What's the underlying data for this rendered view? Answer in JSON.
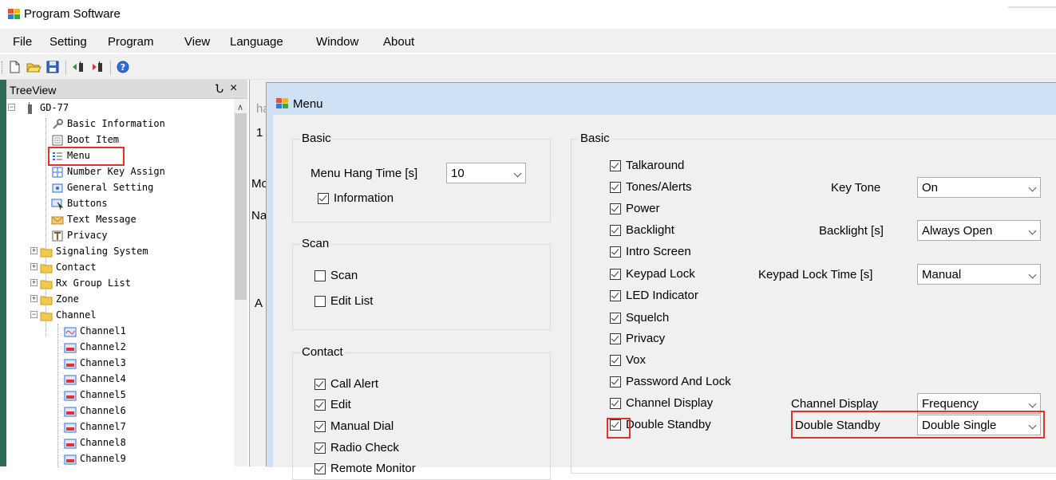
{
  "app": {
    "title": "Program Software"
  },
  "menubar": {
    "items": [
      "File",
      "Setting",
      "Program",
      "View",
      "Language",
      "Window",
      "About"
    ]
  },
  "toolbar": {
    "icons": [
      "new-file-icon",
      "open-folder-icon",
      "save-icon",
      "read-from-radio-icon",
      "write-to-radio-icon",
      "help-icon"
    ]
  },
  "treeview": {
    "title": "TreeView",
    "pin_glyph": "Ն",
    "close_glyph": "×",
    "root": "GD-77",
    "items": [
      "Basic Information",
      "Boot Item",
      "Menu",
      "Number Key Assign",
      "General Setting",
      "Buttons",
      "Text Message",
      "Privacy",
      "Signaling System",
      "Contact",
      "Rx Group List",
      "Zone",
      "Channel"
    ],
    "channels": [
      "Channel1",
      "Channel2",
      "Channel3",
      "Channel4",
      "Channel5",
      "Channel6",
      "Channel7",
      "Channel8",
      "Channel9"
    ]
  },
  "behind": {
    "fragments": [
      "har",
      "1",
      "Mo",
      "Nai",
      "A"
    ]
  },
  "dialog": {
    "title": "Menu",
    "basic_left": {
      "title": "Basic",
      "hang_label": "Menu Hang Time [s]",
      "hang_value": "10",
      "information": "Information"
    },
    "scan": {
      "title": "Scan",
      "items": [
        "Scan",
        "Edit List"
      ]
    },
    "contact": {
      "title": "Contact",
      "items": [
        "Call Alert",
        "Edit",
        "Manual Dial",
        "Radio Check",
        "Remote Monitor"
      ]
    },
    "basic_right": {
      "title": "Basic",
      "items": [
        "Talkaround",
        "Tones/Alerts",
        "Power",
        "Backlight",
        "Intro Screen",
        "Keypad Lock",
        "LED Indicator",
        "Squelch",
        "Privacy",
        "Vox",
        "Password And Lock",
        "Channel Display",
        "Double Standby"
      ],
      "fields": {
        "key_tone": {
          "label": "Key Tone",
          "value": "On"
        },
        "backlight": {
          "label": "Backlight [s]",
          "value": "Always Open"
        },
        "keypad_lock_time": {
          "label": "Keypad Lock Time [s]",
          "value": "Manual"
        },
        "channel_display": {
          "label": "Channel Display",
          "value": "Frequency"
        },
        "double_standby": {
          "label": "Double Standby",
          "value": "Double Single"
        }
      }
    }
  },
  "colors": {
    "highlight": "#e0312f",
    "dialog_title": "#cfe2f5",
    "tree_accent": "#2f6b52"
  }
}
